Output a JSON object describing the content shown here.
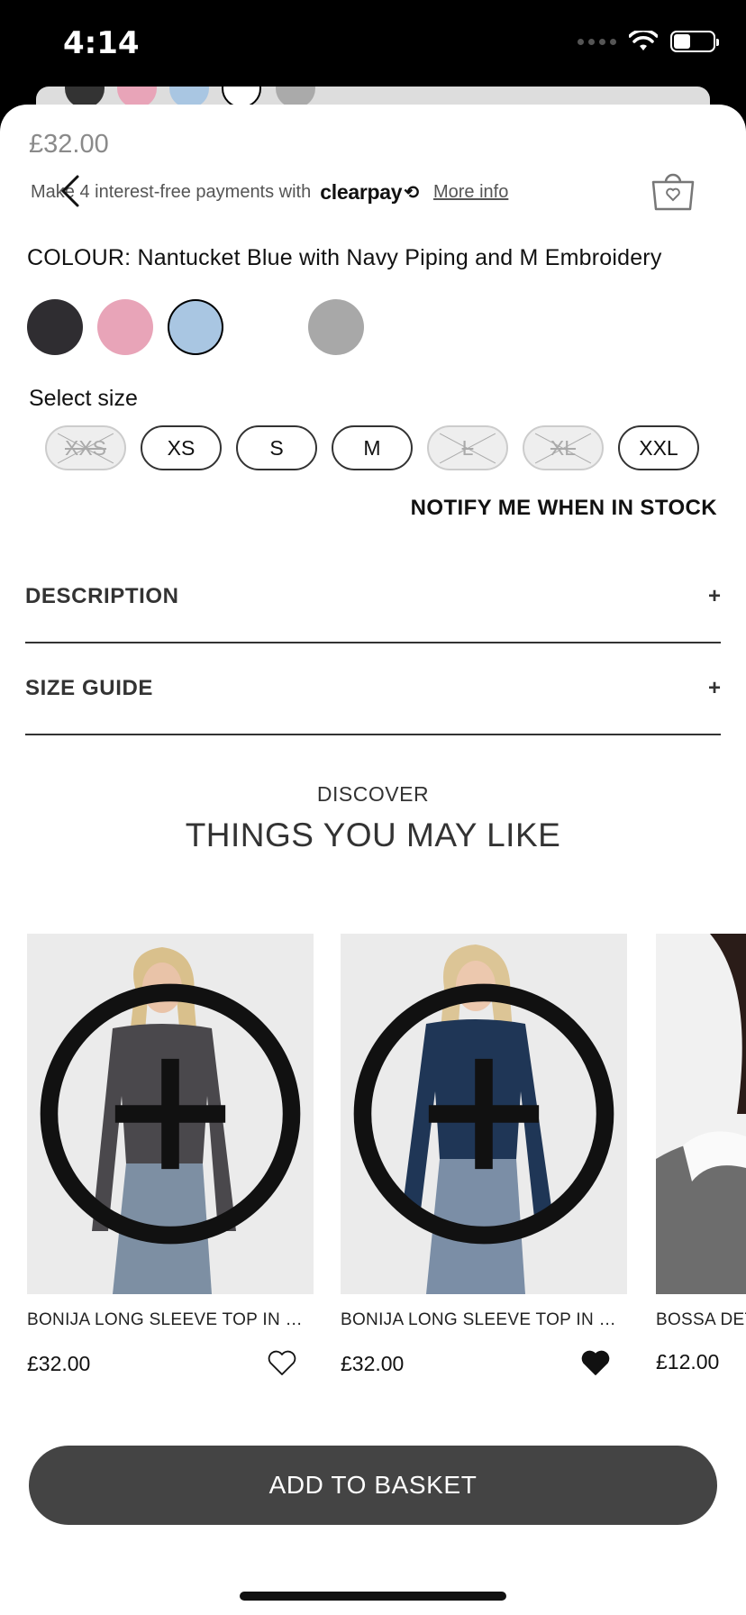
{
  "status_bar": {
    "time": "4:14"
  },
  "product": {
    "price": "£32.00",
    "clearpay_text": "Make 4 interest-free payments with",
    "clearpay_logo": "clearpay",
    "clearpay_more": "More info",
    "colour_label": "COLOUR: Nantucket Blue with Navy Piping and M Embroidery",
    "swatches": [
      {
        "name": "charcoal",
        "color": "#2f2d31"
      },
      {
        "name": "pink",
        "color": "#e8a4b8"
      },
      {
        "name": "blue",
        "color": "#a9c6e2",
        "selected": true
      },
      {
        "name": "white",
        "color": "#ffffff"
      },
      {
        "name": "grey",
        "color": "#a8a8a8"
      }
    ],
    "size_label": "Select size",
    "sizes": [
      {
        "label": "XXS",
        "available": false
      },
      {
        "label": "XS",
        "available": true
      },
      {
        "label": "S",
        "available": true
      },
      {
        "label": "M",
        "available": true
      },
      {
        "label": "L",
        "available": false
      },
      {
        "label": "XL",
        "available": false
      },
      {
        "label": "XXL",
        "available": true
      }
    ],
    "notify": "NOTIFY ME WHEN IN STOCK"
  },
  "accordions": {
    "description": "DESCRIPTION",
    "size_guide": "SIZE GUIDE",
    "expand_symbol": "+"
  },
  "recommendations": {
    "eyebrow": "DISCOVER",
    "title": "THINGS YOU MAY LIKE",
    "items": [
      {
        "name": "BONIJA LONG SLEEVE TOP IN BE...",
        "price": "£32.00",
        "wishlisted": false,
        "top_color": "#4a484c"
      },
      {
        "name": "BONIJA LONG SLEEVE TOP IN NA...",
        "price": "£32.00",
        "wishlisted": true,
        "top_color": "#1f3656"
      },
      {
        "name": "BOSSA DET",
        "price": "£12.00",
        "wishlisted": false,
        "top_color": "#6d6d6d"
      }
    ]
  },
  "cta": {
    "add_to_basket": "ADD TO BASKET"
  }
}
